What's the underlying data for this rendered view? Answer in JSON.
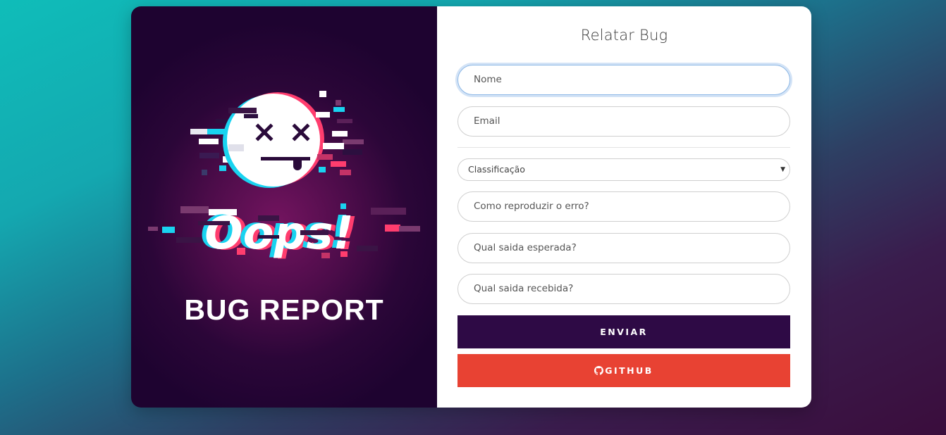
{
  "hero": {
    "oops_text": "Oops!",
    "caption": "BUG REPORT"
  },
  "form": {
    "title": "Relatar Bug",
    "name_placeholder": "Nome",
    "email_placeholder": "Email",
    "classification_selected": "Classificação",
    "reproduce_placeholder": "Como reproduzir o erro?",
    "expected_placeholder": "Qual saida esperada?",
    "received_placeholder": "Qual saida recebida?",
    "submit_label": "ENVIAR",
    "github_label": "GITHUB"
  },
  "colors": {
    "submit_bg": "#2e0a45",
    "github_bg": "#e84233",
    "glitch_cyan": "#19d3f0",
    "glitch_pink": "#ff3d6e"
  }
}
